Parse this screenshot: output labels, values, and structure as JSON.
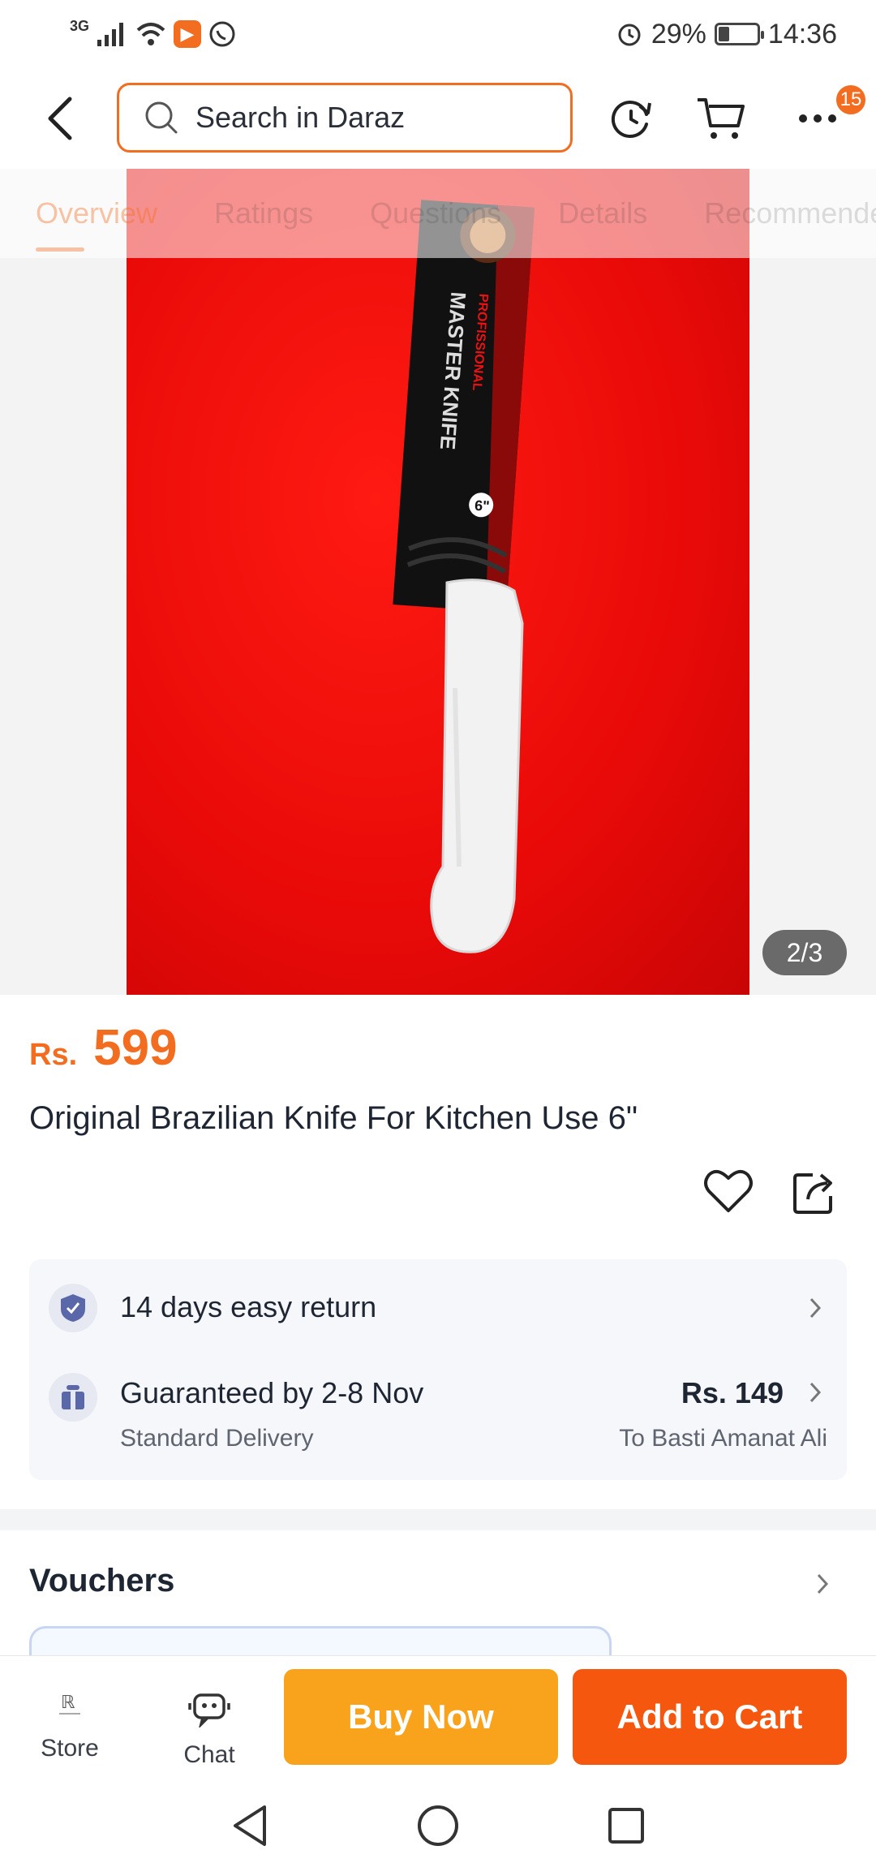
{
  "status_bar": {
    "network": "3G",
    "battery_percent": "29%",
    "battery_level": 0.29,
    "time": "14:36"
  },
  "search": {
    "placeholder": "Search in Daraz"
  },
  "header": {
    "cart_badge": "15"
  },
  "tabs": [
    "Overview",
    "Ratings",
    "Questions",
    "Details",
    "Recommended"
  ],
  "gallery": {
    "counter": "2/3"
  },
  "product": {
    "currency": "Rs.",
    "price": "599",
    "title": "Original Brazilian Knife For Kitchen Use 6\""
  },
  "delivery": {
    "return_text": "14 days easy return",
    "guarantee_text": "Guaranteed by 2-8 Nov",
    "delivery_type": "Standard Delivery",
    "delivery_price": "Rs. 149",
    "destination": "To Basti Amanat Ali"
  },
  "vouchers": {
    "title": "Vouchers"
  },
  "bottom_bar": {
    "store_label": "Store",
    "chat_label": "Chat",
    "buy_now_label": "Buy Now",
    "add_to_cart_label": "Add to Cart"
  },
  "colors": {
    "accent": "#f36d21",
    "buy_now": "#f9a31c",
    "add_to_cart": "#f5570f"
  }
}
